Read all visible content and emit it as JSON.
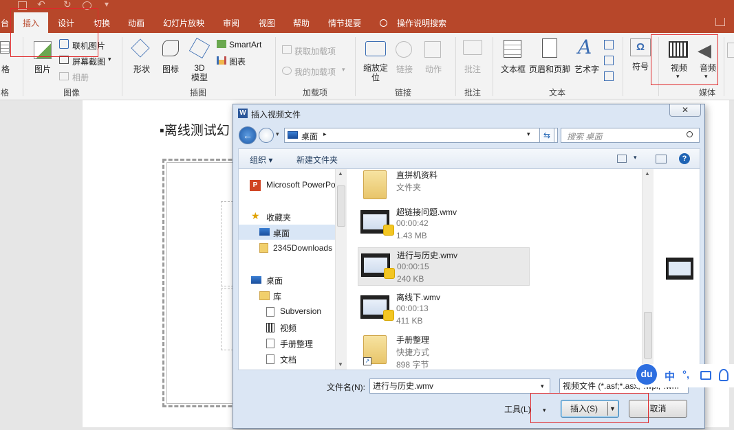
{
  "ribbon_tabs": [
    {
      "label": "台"
    },
    {
      "label": "插入"
    },
    {
      "label": "设计"
    },
    {
      "label": "切换"
    },
    {
      "label": "动画"
    },
    {
      "label": "幻灯片放映"
    },
    {
      "label": "审阅"
    },
    {
      "label": "视图"
    },
    {
      "label": "帮助"
    },
    {
      "label": "情节提要"
    }
  ],
  "tell_me": "操作说明搜索",
  "ribbon": {
    "table_partial": "格",
    "images": {
      "picture": "图片",
      "online_pictures": "联机图片",
      "screenshot": "屏幕截图",
      "album": "相册",
      "group": "图像"
    },
    "illustrations": {
      "shapes": "形状",
      "icons": "图标",
      "model_3d_line1": "3D",
      "model_3d_line2": "模型",
      "smartart": "SmartArt",
      "chart": "图表",
      "group": "插图"
    },
    "addins": {
      "get": "获取加载项",
      "my": "我的加载项",
      "group": "加载项"
    },
    "links": {
      "zoom_line1": "缩放定",
      "zoom_line2": "位",
      "link": "链接",
      "action": "动作",
      "group": "链接"
    },
    "comments": {
      "comment": "批注",
      "group": "批注"
    },
    "text": {
      "textbox": "文本框",
      "header_footer": "页眉和页脚",
      "wordart": "艺术字",
      "group": "文本"
    },
    "symbols": {
      "symbol": "符号"
    },
    "media": {
      "video": "视频",
      "audio": "音频",
      "group": "媒体"
    }
  },
  "slide": {
    "title": "离线测试幻"
  },
  "dialog": {
    "title": "插入视频文件",
    "close": "✕",
    "address": "桌面",
    "search_placeholder": "搜索 桌面",
    "toolbar": {
      "organize": "组织",
      "new_folder": "新建文件夹"
    },
    "nav_tree": [
      {
        "label": "Microsoft PowerPoint",
        "icon": "powerpoint-icon"
      },
      {
        "label": "收藏夹",
        "icon": "star-icon"
      },
      {
        "label": "桌面",
        "icon": "desktop-icon",
        "selected": true
      },
      {
        "label": "2345Downloads",
        "icon": "folder-icon"
      },
      {
        "label": "桌面",
        "icon": "desktop-icon"
      },
      {
        "label": "库",
        "icon": "library-icon"
      },
      {
        "label": "Subversion",
        "icon": "document-icon"
      },
      {
        "label": "视频",
        "icon": "video-library-icon"
      },
      {
        "label": "手册整理",
        "icon": "document-icon"
      },
      {
        "label": "文档",
        "icon": "document-icon"
      }
    ],
    "files": [
      {
        "name": "直拼机资料",
        "line2": "文件夹",
        "line3": "",
        "kind": "folder"
      },
      {
        "name": "超链接问题.wmv",
        "line2": "00:00:42",
        "line3": "1.43 MB",
        "kind": "video"
      },
      {
        "name": "进行与历史.wmv",
        "line2": "00:00:15",
        "line3": "240 KB",
        "kind": "video",
        "selected": true
      },
      {
        "name": "离线下.wmv",
        "line2": "00:00:13",
        "line3": "411 KB",
        "kind": "video"
      },
      {
        "name": "手册整理",
        "line2": "快捷方式",
        "line3": "898 字节",
        "kind": "shortcut"
      }
    ],
    "filename_label": "文件名(N):",
    "filename_value": "进行与历史.wmv",
    "filetype_value": "视频文件 (*.asf;*.asx;*.wpl;*.wm",
    "tools": "工具(L)",
    "insert": "插入(S)",
    "cancel": "取消"
  },
  "ime": {
    "logo": "du",
    "lang": "中",
    "punct": "°,"
  },
  "colors": {
    "ribbon_brand": "#b7472a",
    "highlight": "#e0282a"
  }
}
